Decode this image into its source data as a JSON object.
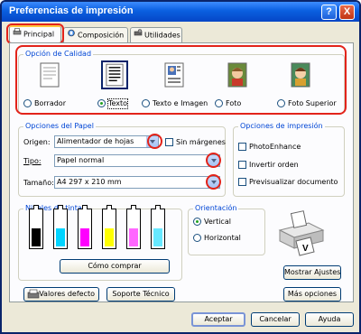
{
  "window": {
    "title": "Preferencias de impresión",
    "help_label": "?",
    "close_label": "X"
  },
  "tabs": [
    {
      "label": "Principal",
      "icon": "printer-icon"
    },
    {
      "label": "Composición",
      "icon": "layout-icon"
    },
    {
      "label": "Utilidades",
      "icon": "utilities-icon"
    }
  ],
  "quality": {
    "label": "Opción de Calidad",
    "options": [
      {
        "label": "Borrador",
        "selected": false
      },
      {
        "label": "Texto",
        "selected": true
      },
      {
        "label": "Texto e Imagen",
        "selected": false
      },
      {
        "label": "Foto",
        "selected": false
      },
      {
        "label": "Foto Superior",
        "selected": false
      }
    ]
  },
  "paper": {
    "label": "Opciones del Papel",
    "origin_label": "Origen:",
    "origin_value": "Alimentador de hojas",
    "borderless_label": "Sin márgenes",
    "type_label": "Tipo:",
    "type_value": "Papel normal",
    "size_label": "Tamaño:",
    "size_value": "A4 297 x 210 mm"
  },
  "print_options": {
    "label": "Opciones de impresión",
    "photo_enhance": "PhotoEnhance",
    "reverse_order": "Invertir orden",
    "preview": "Previsualizar documento"
  },
  "ink": {
    "label": "Niveles de tinta",
    "how_to_buy": "Cómo comprar",
    "colors": [
      "#000000",
      "#00d4ff",
      "#ff00ff",
      "#ffff00",
      "#ff66ff",
      "#66e8ff"
    ]
  },
  "orientation": {
    "label": "Orientación",
    "vertical": "Vertical",
    "horizontal": "Horizontal",
    "selected": "vertical"
  },
  "buttons": {
    "show_settings": "Mostrar Ajustes",
    "more_options": "Más opciones",
    "defaults": "Valores defecto",
    "tech_support": "Soporte Técnico",
    "accept": "Aceptar",
    "cancel": "Cancelar",
    "help": "Ayuda"
  },
  "colors": {
    "accent": "#0046d5",
    "highlight": "#e2231a",
    "titlebar": "#0a5fe0"
  }
}
